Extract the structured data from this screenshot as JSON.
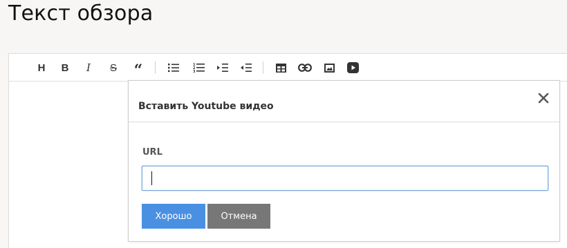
{
  "page": {
    "title": "Текст обзора"
  },
  "toolbar": {
    "heading_label": "H",
    "bold_label": "B",
    "italic_label": "I",
    "strike_label": "S",
    "quote_label": "“",
    "icons": [
      "heading-icon",
      "bold-icon",
      "italic-icon",
      "strikethrough-icon",
      "blockquote-icon",
      "bulleted-list-icon",
      "numbered-list-icon",
      "indent-icon",
      "outdent-icon",
      "table-icon",
      "link-icon",
      "image-icon",
      "youtube-video-icon"
    ]
  },
  "modal": {
    "title": "Вставить Youtube видео",
    "url_label": "URL",
    "url_value": "",
    "ok_label": "Хорошо",
    "cancel_label": "Отмена",
    "close_symbol": "×"
  },
  "colors": {
    "primary_button": "#4a90e2",
    "secondary_button": "#777777",
    "input_focus_border": "#7ea9dd"
  }
}
